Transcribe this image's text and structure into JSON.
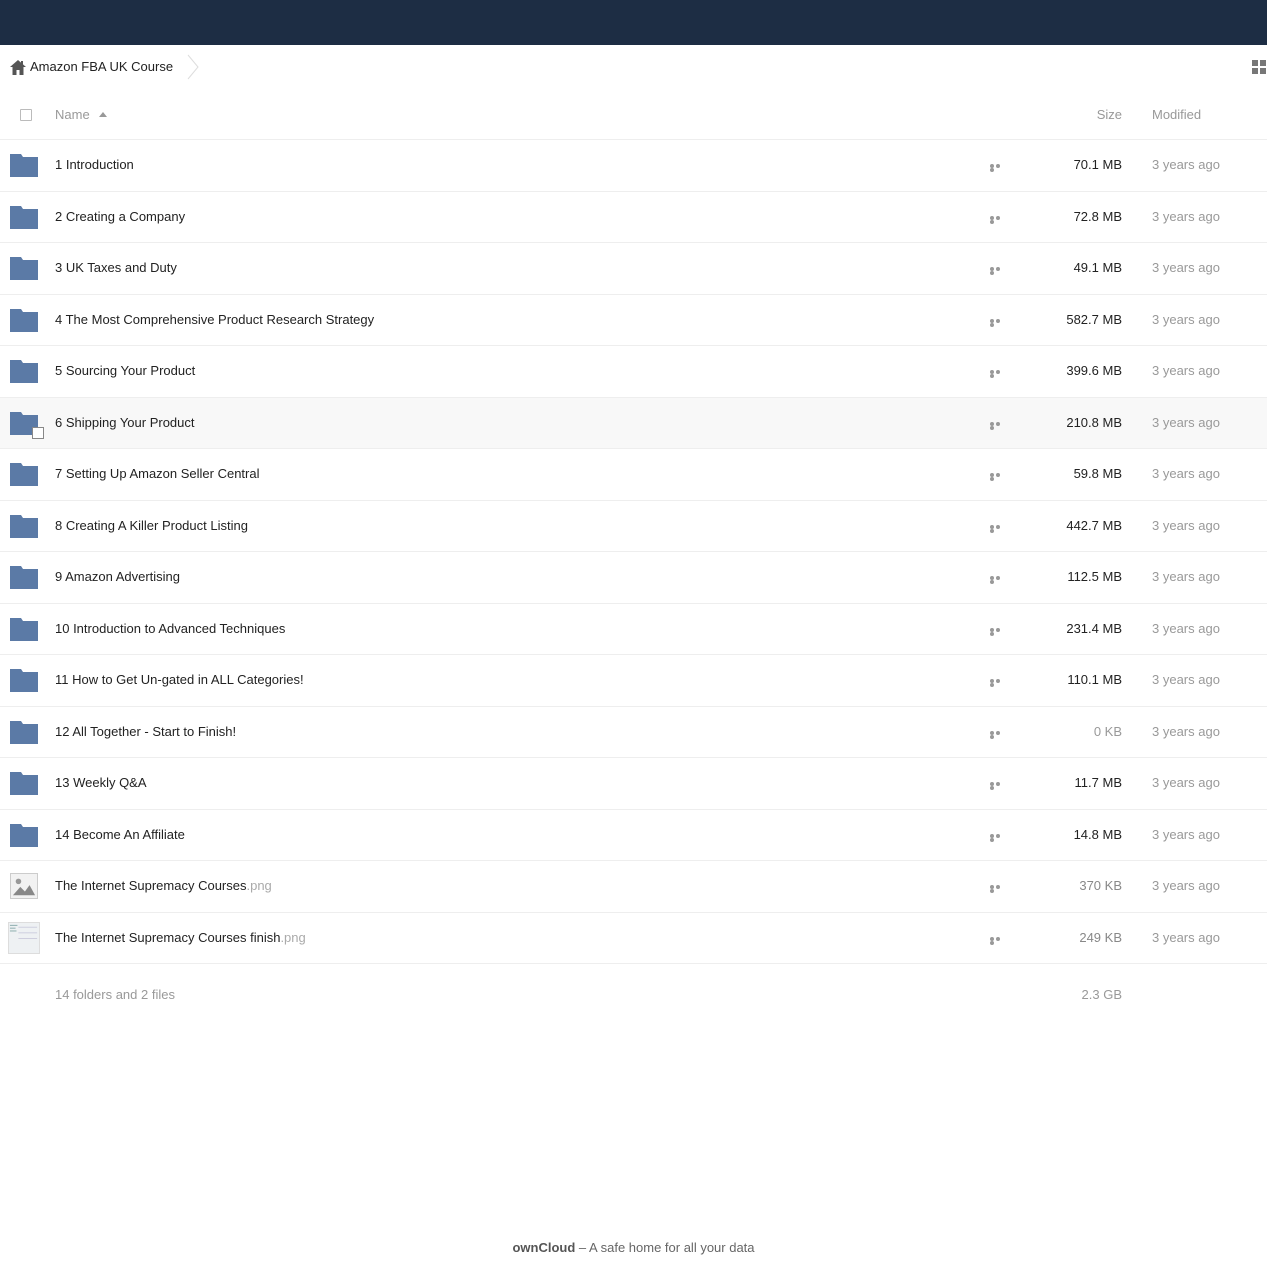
{
  "breadcrumb": {
    "label": "Amazon FBA UK Course",
    "home_icon": "home-icon"
  },
  "view_toggle_icon": "grid-view-icon",
  "columns": {
    "name": "Name",
    "size": "Size",
    "modified": "Modified"
  },
  "files": [
    {
      "name": "1 Introduction",
      "ext": "",
      "type": "folder",
      "size": "70.1 MB",
      "modified": "3 years ago"
    },
    {
      "name": "2 Creating a Company",
      "ext": "",
      "type": "folder",
      "size": "72.8 MB",
      "modified": "3 years ago"
    },
    {
      "name": "3 UK Taxes and Duty",
      "ext": "",
      "type": "folder",
      "size": "49.1 MB",
      "modified": "3 years ago"
    },
    {
      "name": "4 The Most Comprehensive Product Research Strategy",
      "ext": "",
      "type": "folder",
      "size": "582.7 MB",
      "modified": "3 years ago"
    },
    {
      "name": "5 Sourcing Your Product",
      "ext": "",
      "type": "folder",
      "size": "399.6 MB",
      "modified": "3 years ago"
    },
    {
      "name": "6 Shipping Your Product",
      "ext": "",
      "type": "folder",
      "size": "210.8 MB",
      "modified": "3 years ago"
    },
    {
      "name": "7 Setting Up Amazon Seller Central",
      "ext": "",
      "type": "folder",
      "size": "59.8 MB",
      "modified": "3 years ago"
    },
    {
      "name": "8 Creating A Killer Product Listing",
      "ext": "",
      "type": "folder",
      "size": "442.7 MB",
      "modified": "3 years ago"
    },
    {
      "name": "9 Amazon Advertising",
      "ext": "",
      "type": "folder",
      "size": "112.5 MB",
      "modified": "3 years ago"
    },
    {
      "name": "10 Introduction to Advanced Techniques",
      "ext": "",
      "type": "folder",
      "size": "231.4 MB",
      "modified": "3 years ago"
    },
    {
      "name": "11 How to Get Un-gated in ALL Categories!",
      "ext": "",
      "type": "folder",
      "size": "110.1 MB",
      "modified": "3 years ago"
    },
    {
      "name": "12 All Together - Start to Finish!",
      "ext": "",
      "type": "folder",
      "size": "0 KB",
      "modified": "3 years ago"
    },
    {
      "name": "13 Weekly Q&A",
      "ext": "",
      "type": "folder",
      "size": "11.7 MB",
      "modified": "3 years ago"
    },
    {
      "name": "14 Become An Affiliate",
      "ext": "",
      "type": "folder",
      "size": "14.8 MB",
      "modified": "3 years ago"
    },
    {
      "name": "The Internet Supremacy Courses",
      "ext": ".png",
      "type": "image",
      "size": "370 KB",
      "modified": "3 years ago"
    },
    {
      "name": "The Internet Supremacy Courses finish",
      "ext": ".png",
      "type": "screenshot",
      "size": "249 KB",
      "modified": "3 years ago"
    }
  ],
  "summary": {
    "text": "14 folders and 2 files",
    "total": "2.3 GB"
  },
  "footer": {
    "brand": "ownCloud",
    "tagline": " – A safe home for all your data"
  },
  "colors": {
    "topbar": "#1d2d44",
    "folder": "#5b7aa6"
  }
}
